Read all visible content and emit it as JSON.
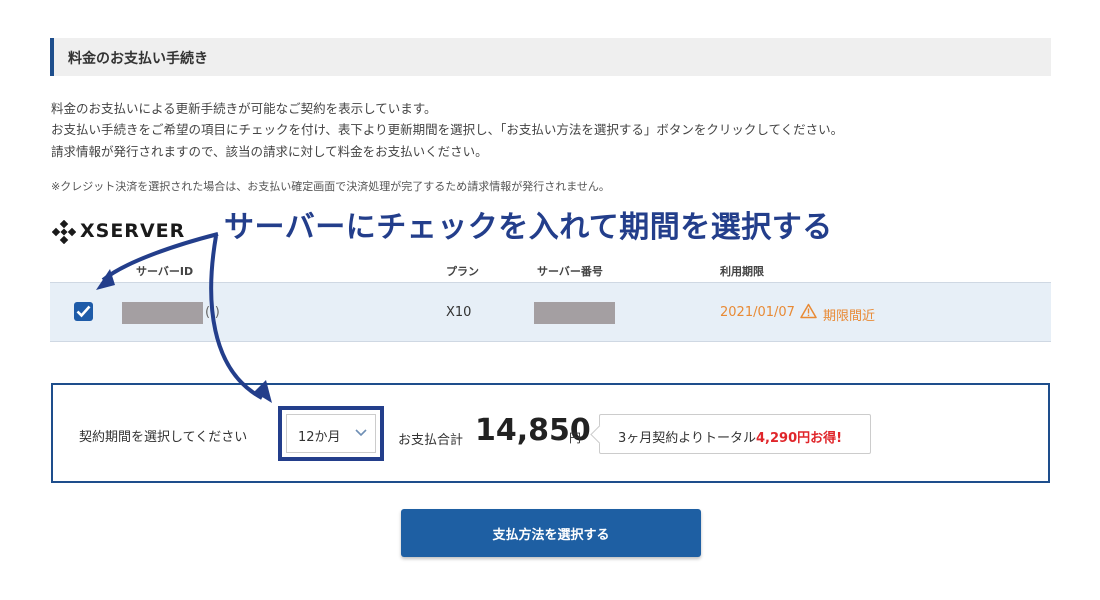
{
  "section": {
    "title": "料金のお支払い手続き"
  },
  "description": {
    "line1": "料金のお支払いによる更新手続きが可能なご契約を表示しています。",
    "line2": "お支払い手続きをご希望の項目にチェックを付け、表下より更新期間を選択し、「お支払い方法を選択する」ボタンをクリックしてください。",
    "line3": "請求情報が発行されますので、該当の請求に対して料金をお支払いください。",
    "note": "※クレジット決済を選択された場合は、お支払い確定画面で決済処理が完了するため請求情報が発行されません。"
  },
  "brand": {
    "name": "XSERVER"
  },
  "annotation": "サーバーにチェックを入れて期間を選択する",
  "table": {
    "headers": {
      "server_id": "サーバーID",
      "plan": "プラン",
      "server_number": "サーバー番号",
      "expiry": "利用期限"
    },
    "row": {
      "checked": true,
      "paren": "(-)",
      "plan": "X10",
      "expiry_date": "2021/01/07",
      "expiry_status": "期限間近"
    }
  },
  "period": {
    "label": "契約期間を選択してください",
    "selected": "12か月",
    "total_label": "お支払合計",
    "total_amount": "14,850",
    "total_unit": "円",
    "savings_text": "3ヶ月契約よりトータル",
    "savings_amount": "4,290円お得!"
  },
  "button": {
    "pay_label": "支払方法を選択する"
  },
  "colors": {
    "accent": "#1e4e8c",
    "annotation": "#233e8b",
    "warning": "#e88a35",
    "savings": "#e0262b",
    "button": "#1e5fa3"
  },
  "icons": [
    "xserver-logo-icon",
    "checkbox-checked-icon",
    "warning-icon",
    "chevron-down-icon",
    "annotation-arrow-icon"
  ]
}
